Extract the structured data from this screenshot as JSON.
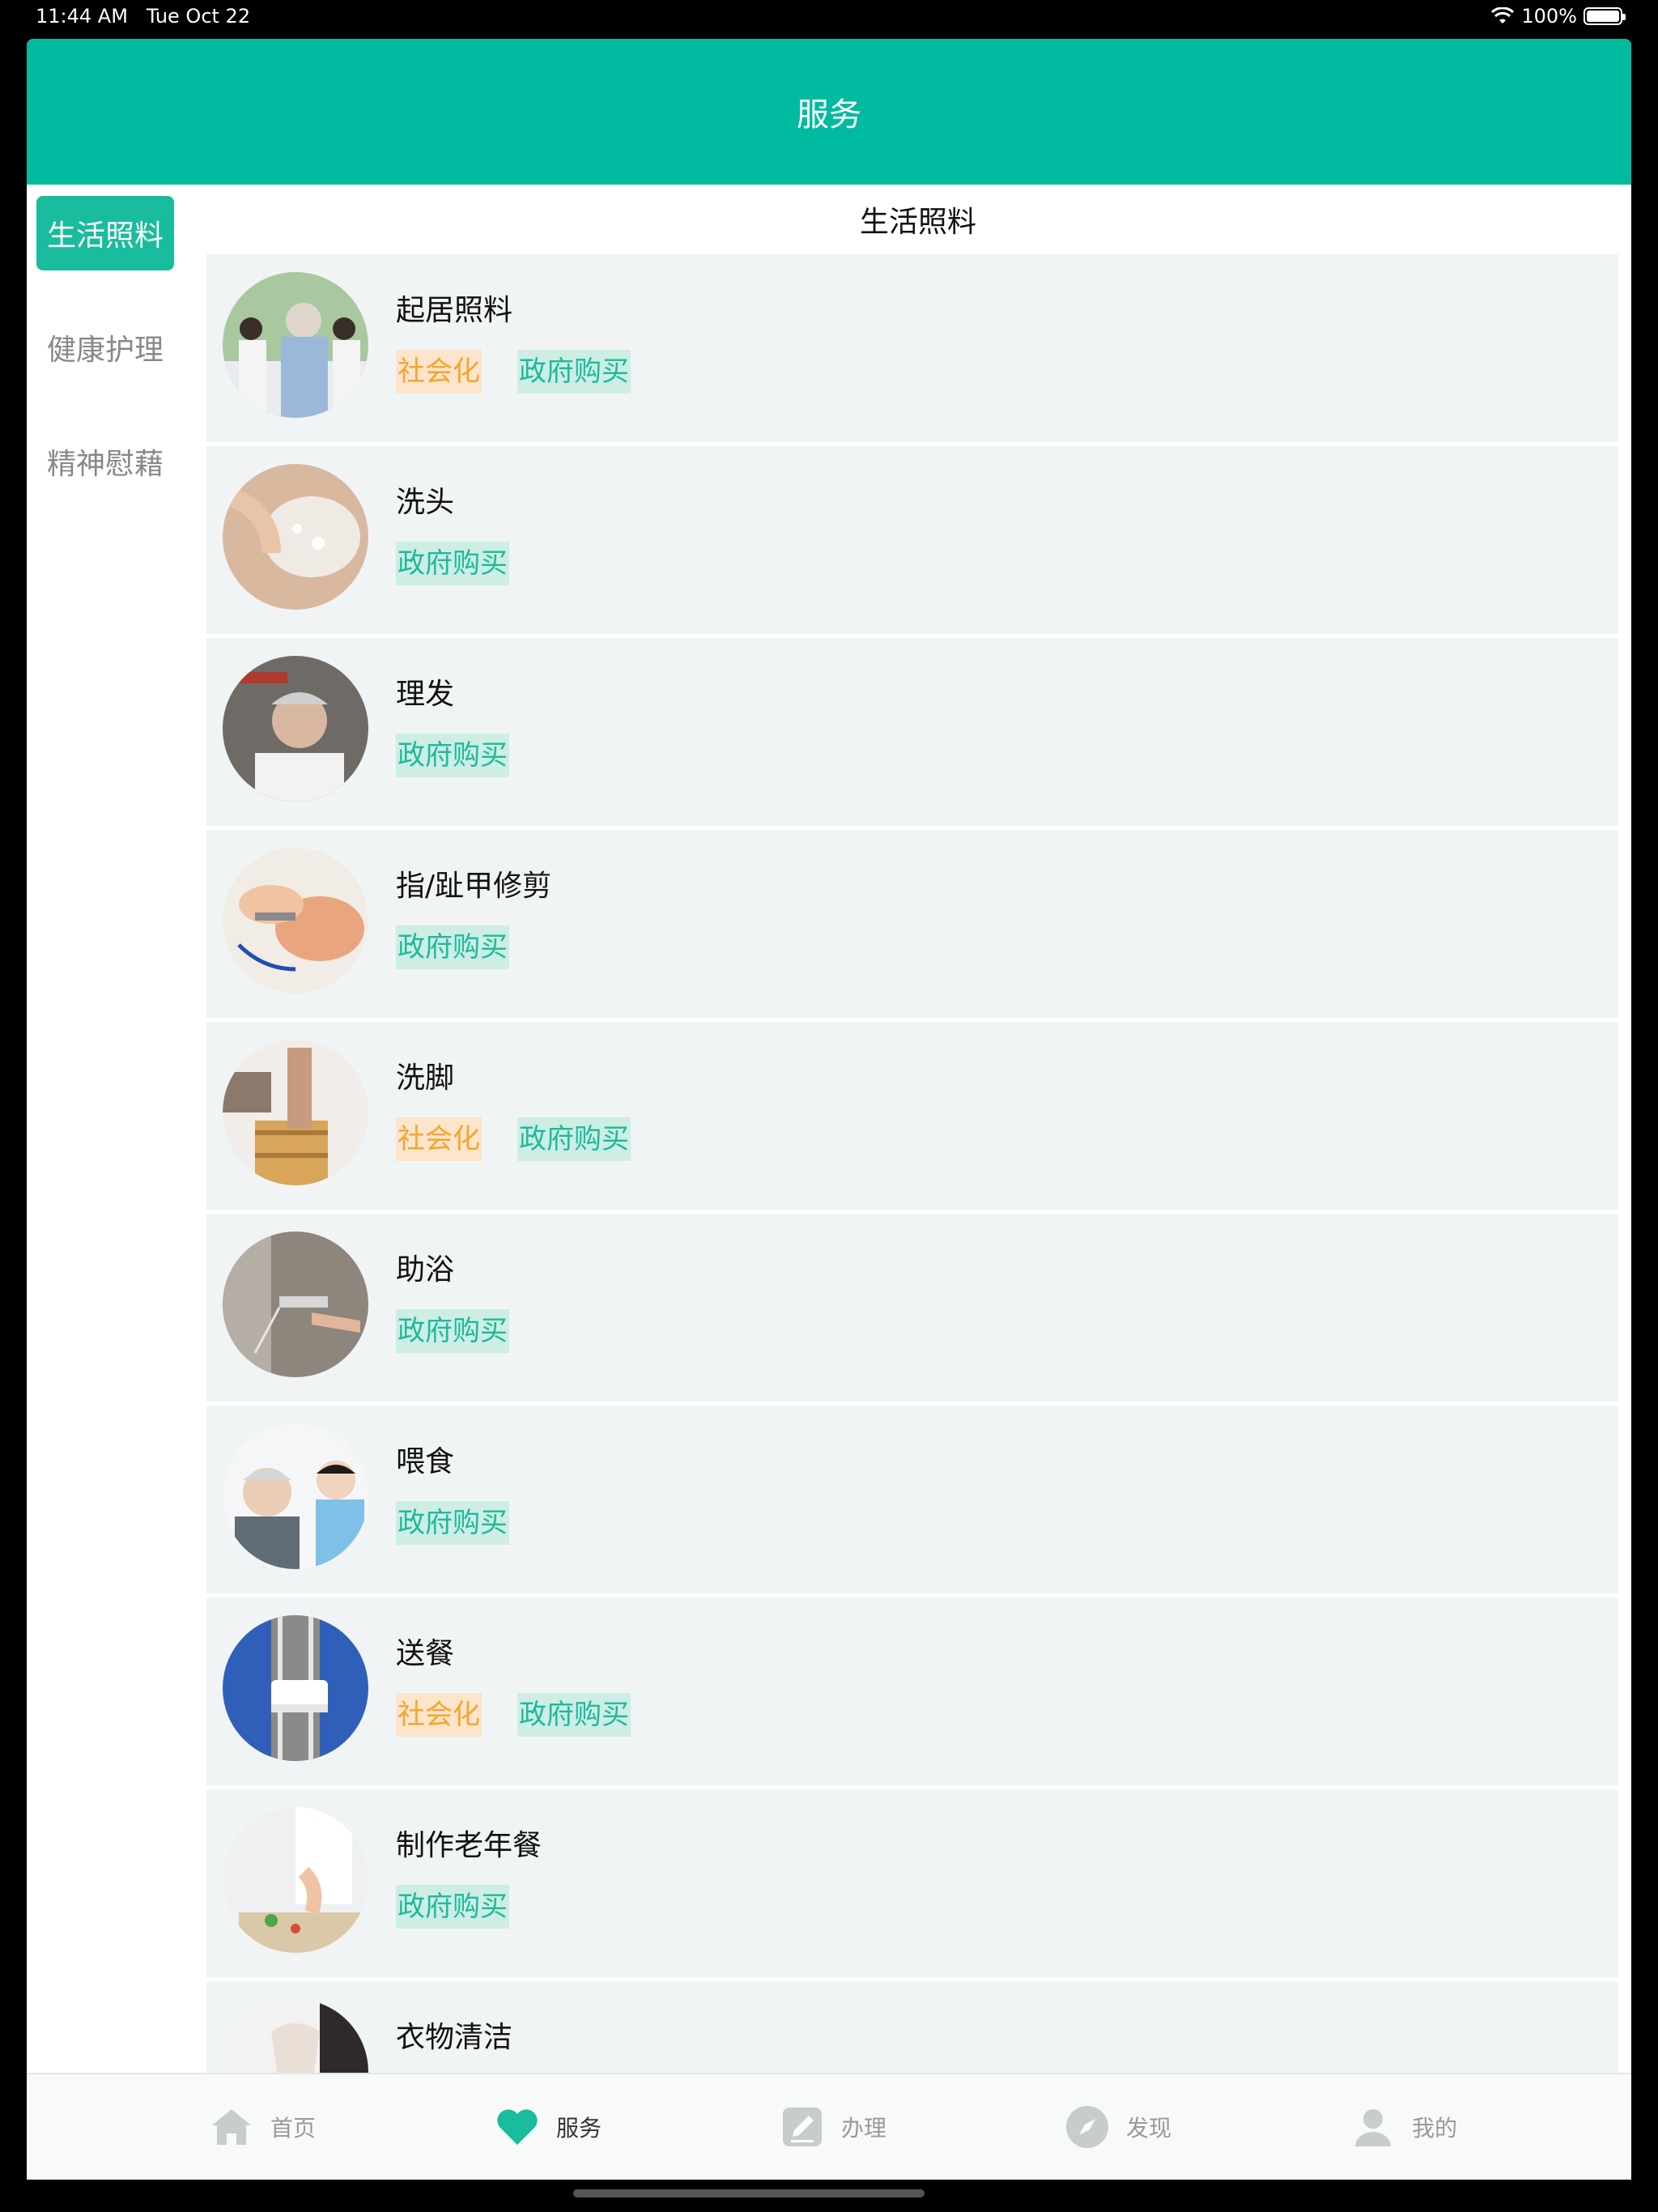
{
  "status_bar": {
    "time": "11:44 AM",
    "date": "Tue Oct 22",
    "battery": "100%"
  },
  "header": {
    "title": "服务"
  },
  "sidebar": {
    "items": [
      {
        "label": "生活照料",
        "active": true
      },
      {
        "label": "健康护理",
        "active": false
      },
      {
        "label": "精神慰藉",
        "active": false
      }
    ]
  },
  "content": {
    "section_title": "生活照料",
    "services": [
      {
        "title": "起居照料",
        "tags": [
          "社会化",
          "政府购买"
        ],
        "image": "caregivers-with-elderly"
      },
      {
        "title": "洗头",
        "tags": [
          "政府购买"
        ],
        "image": "hair-washing"
      },
      {
        "title": "理发",
        "tags": [
          "政府购买"
        ],
        "image": "haircut"
      },
      {
        "title": "指/趾甲修剪",
        "tags": [
          "政府购买"
        ],
        "image": "nail-trimming"
      },
      {
        "title": "洗脚",
        "tags": [
          "社会化",
          "政府购买"
        ],
        "image": "foot-washing"
      },
      {
        "title": "助浴",
        "tags": [
          "政府购买"
        ],
        "image": "shower"
      },
      {
        "title": "喂食",
        "tags": [
          "政府购买"
        ],
        "image": "feeding"
      },
      {
        "title": "送餐",
        "tags": [
          "社会化",
          "政府购买"
        ],
        "image": "meal-delivery"
      },
      {
        "title": "制作老年餐",
        "tags": [
          "政府购买"
        ],
        "image": "cooking"
      },
      {
        "title": "衣物清洁",
        "tags": [],
        "image": "laundry"
      }
    ]
  },
  "tabbar": {
    "items": [
      {
        "label": "首页",
        "icon": "home-icon",
        "active": false
      },
      {
        "label": "服务",
        "icon": "heart-icon",
        "active": true
      },
      {
        "label": "办理",
        "icon": "edit-icon",
        "active": false
      },
      {
        "label": "发现",
        "icon": "compass-icon",
        "active": false
      },
      {
        "label": "我的",
        "icon": "user-icon",
        "active": false
      }
    ]
  },
  "colors": {
    "accent": "#00BB9F",
    "social_tag": "#F5A431",
    "gov_tag": "#1DBA9B"
  }
}
